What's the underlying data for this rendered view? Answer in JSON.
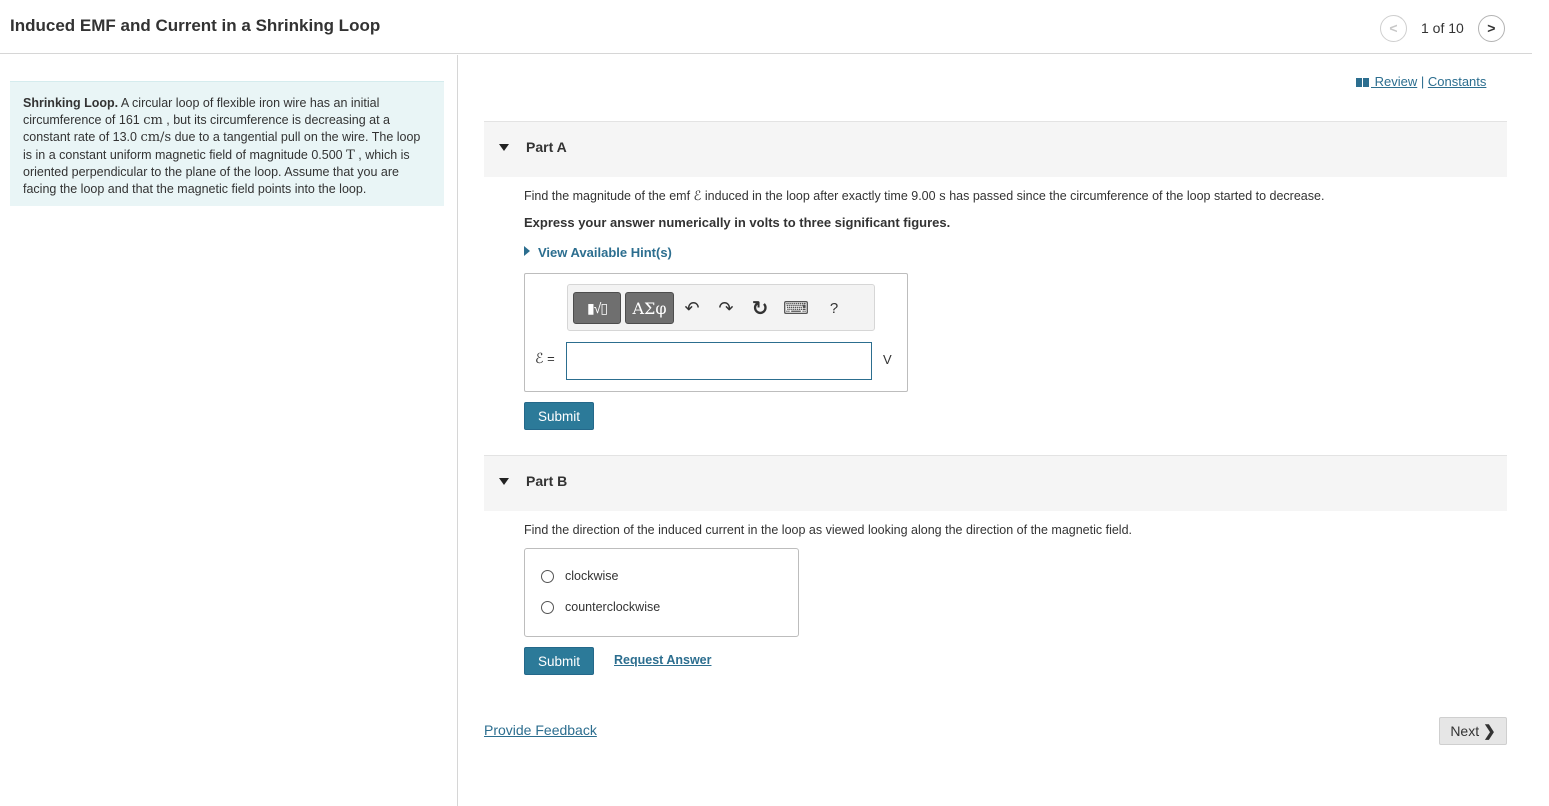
{
  "header": {
    "title": "Induced EMF and Current in a Shrinking Loop",
    "pager": {
      "text": "1 of 10",
      "prev_icon": "<",
      "next_icon": ">"
    }
  },
  "intro": {
    "heading": "Shrinking Loop.",
    "t1": " A circular loop of flexible iron wire has an initial circumference of 161 ",
    "u1": "cm",
    "t2": " , but its circumference is decreasing at a constant rate of 13.0 ",
    "u2": "cm/s",
    "t3": " due to a tangential pull on the wire. The loop is in a constant uniform magnetic field of magnitude 0.500 ",
    "u3": "T",
    "t4": " , which is oriented perpendicular to the plane of the loop. Assume that you are facing the loop and that the magnetic field points into the loop."
  },
  "links": {
    "review": " Review",
    "separator": " | ",
    "constants": "Constants"
  },
  "partA": {
    "label": "Part A",
    "q1": "Find the magnitude of the emf ",
    "symbol": "ℰ",
    "q2": " induced in the loop after exactly time 9.00 ",
    "q_unit": "s",
    "q3": " has passed since the circumference of the loop started to decrease.",
    "instruction": "Express your answer numerically in volts to three significant figures.",
    "hint": "View Available Hint(s)",
    "toolbar": {
      "templates": "▮√▯",
      "greek": "ΑΣφ",
      "undo": "↶",
      "redo": "↷",
      "reset": "↻",
      "keyboard": "⌨",
      "help": "?"
    },
    "eq_symbol": "ℰ",
    "eq_sign": " =",
    "input_value": "",
    "unit": "V",
    "submit": "Submit"
  },
  "partB": {
    "label": "Part B",
    "question": "Find the direction of the induced current in the loop as viewed looking along the direction of the magnetic field.",
    "options": [
      "clockwise",
      "counterclockwise"
    ],
    "submit": "Submit",
    "request_answer": "Request Answer"
  },
  "footer": {
    "feedback": "Provide Feedback",
    "next": "Next",
    "next_icon": "❯"
  }
}
